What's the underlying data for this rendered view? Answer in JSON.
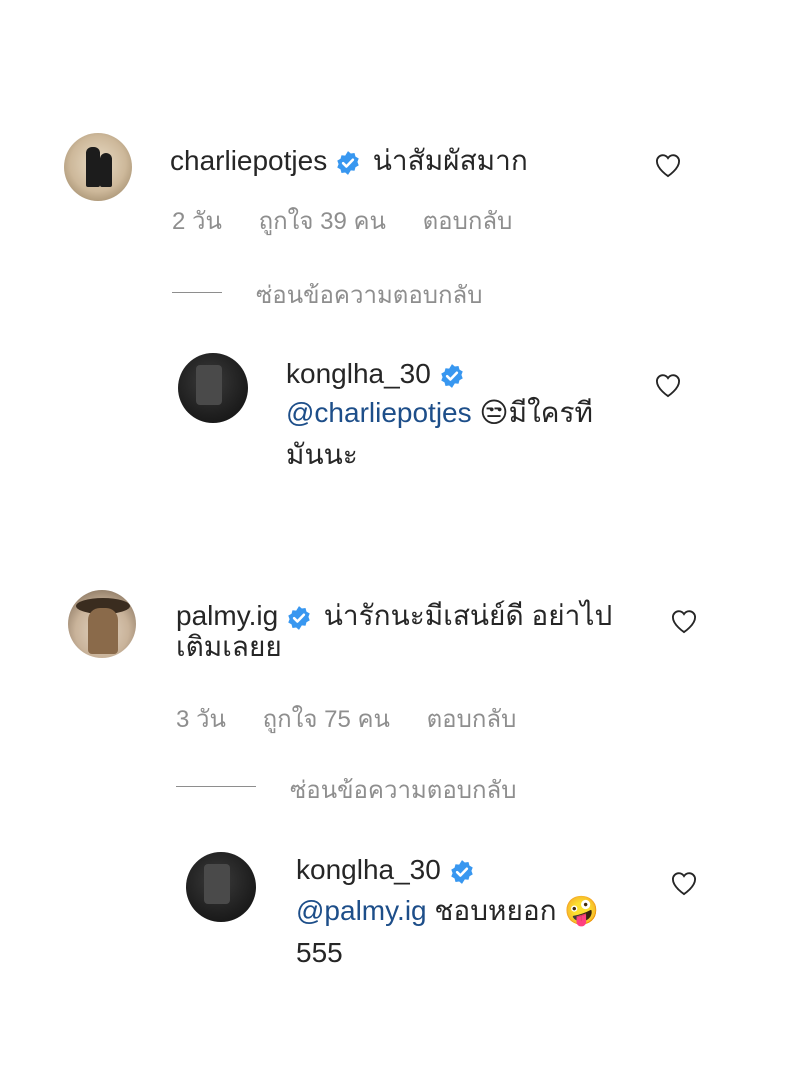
{
  "comments": [
    {
      "username": "charliepotjes",
      "text": "น่าสัมผัสมาก",
      "time": "2 วัน",
      "likes": "ถูกใจ 39 คน",
      "reply": "ตอบกลับ",
      "hide_replies": "ซ่อนข้อความตอบกลับ",
      "reply_item": {
        "username": "konglha_30",
        "mention": "@charliepotjes",
        "emoji": "😒",
        "text_line1": "มีใครที",
        "text_line2": "มันนะ"
      }
    },
    {
      "username": "palmy.ig",
      "text_line1": "น่ารักนะมีเสน่ย์ดี อย่าไป",
      "text_line2": "เติมเลยย",
      "time": "3 วัน",
      "likes": "ถูกใจ 75 คน",
      "reply": "ตอบกลับ",
      "hide_replies": "ซ่อนข้อความตอบกลับ",
      "reply_item": {
        "username": "konglha_30",
        "mention": "@palmy.ig",
        "text_line1": "ชอบหยอก",
        "emoji": "🤪",
        "text_line2": "555"
      }
    }
  ],
  "icons": {
    "verified": "verified-badge-icon",
    "like": "heart-outline-icon"
  },
  "colors": {
    "verified": "#3897f0",
    "mention": "#1d4e89",
    "muted": "#8e8e8e"
  }
}
